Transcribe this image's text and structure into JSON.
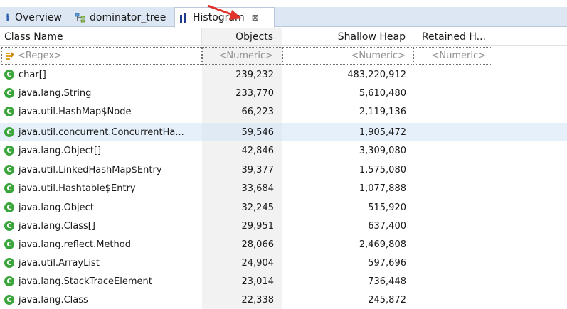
{
  "tabs": [
    {
      "label": "Overview",
      "icon": "info-icon"
    },
    {
      "label": "dominator_tree",
      "icon": "tree-icon"
    },
    {
      "label": "Histogram",
      "icon": "histogram-icon",
      "active": true,
      "close": "⊠"
    }
  ],
  "columns": {
    "class_name": "Class Name",
    "objects": "Objects",
    "shallow_heap": "Shallow Heap",
    "retained_heap": "Retained H..."
  },
  "filter": {
    "regex": "<Regex>",
    "objects": "<Numeric>",
    "shallow_heap": "<Numeric>",
    "retained_heap": "<Numeric>"
  },
  "rows": [
    {
      "name": "char[]",
      "objects": "239,232",
      "shallow": "483,220,912",
      "retained": ""
    },
    {
      "name": "java.lang.String",
      "objects": "233,770",
      "shallow": "5,610,480",
      "retained": ""
    },
    {
      "name": "java.util.HashMap$Node",
      "objects": "66,223",
      "shallow": "2,119,136",
      "retained": ""
    },
    {
      "name": "java.util.concurrent.ConcurrentHa...",
      "objects": "59,546",
      "shallow": "1,905,472",
      "retained": "",
      "selected": true
    },
    {
      "name": "java.lang.Object[]",
      "objects": "42,846",
      "shallow": "3,309,080",
      "retained": ""
    },
    {
      "name": "java.util.LinkedHashMap$Entry",
      "objects": "39,377",
      "shallow": "1,575,080",
      "retained": ""
    },
    {
      "name": "java.util.Hashtable$Entry",
      "objects": "33,684",
      "shallow": "1,077,888",
      "retained": ""
    },
    {
      "name": "java.lang.Object",
      "objects": "32,245",
      "shallow": "515,920",
      "retained": ""
    },
    {
      "name": "java.lang.Class[]",
      "objects": "29,951",
      "shallow": "637,400",
      "retained": ""
    },
    {
      "name": "java.lang.reflect.Method",
      "objects": "28,066",
      "shallow": "2,469,808",
      "retained": ""
    },
    {
      "name": "java.util.ArrayList",
      "objects": "24,904",
      "shallow": "597,696",
      "retained": ""
    },
    {
      "name": "java.lang.StackTraceElement",
      "objects": "23,014",
      "shallow": "736,448",
      "retained": ""
    },
    {
      "name": "java.lang.Class",
      "objects": "22,338",
      "shallow": "245,872",
      "retained": ""
    }
  ],
  "colors": {
    "tab_strip": "#dce7f3",
    "class_icon": "#3aa53a",
    "selection": "#e5f0fb",
    "annotation_arrow": "#e0332b"
  }
}
